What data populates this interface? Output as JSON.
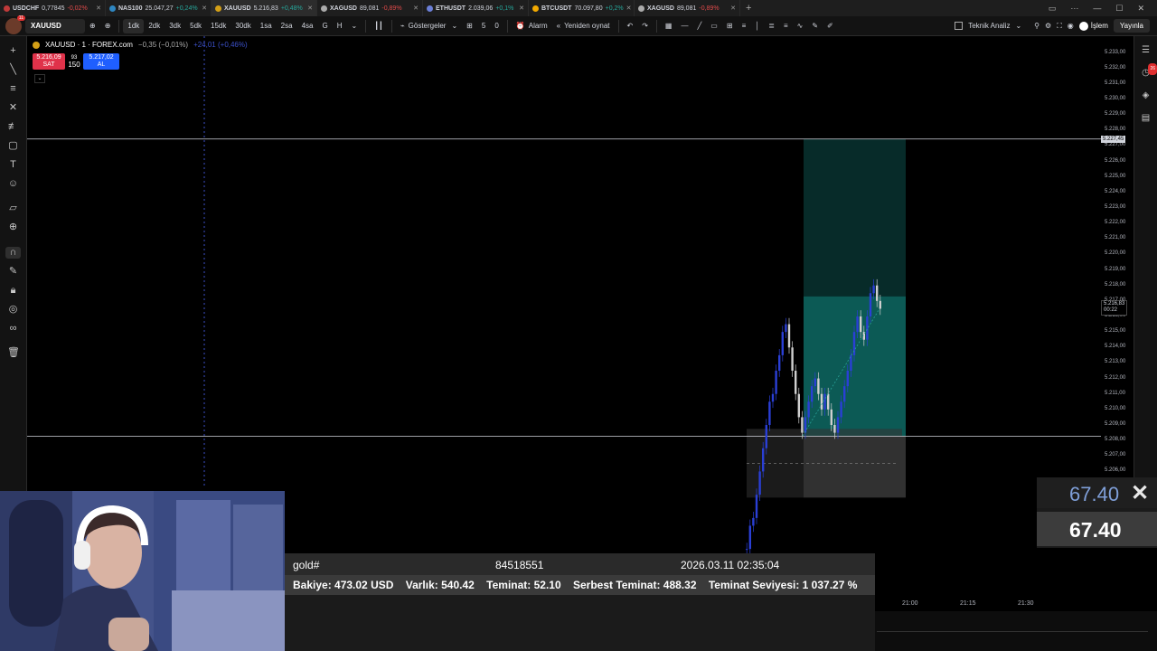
{
  "tabs": [
    {
      "symbol": "USDCHF",
      "price": "0,77845",
      "change": "-0,02%",
      "up": false,
      "color": "#c03a3a"
    },
    {
      "symbol": "NAS100",
      "price": "25.047,27",
      "change": "+0,24%",
      "up": true,
      "color": "#2e86c1"
    },
    {
      "symbol": "XAUUSD",
      "price": "5.216,83",
      "change": "+0,48%",
      "up": true,
      "color": "#d4a017"
    },
    {
      "symbol": "XAGUSD",
      "price": "89,081",
      "change": "-0,89%",
      "up": false,
      "color": "#aaaaaa"
    },
    {
      "symbol": "ETHUSDT",
      "price": "2.039,06",
      "change": "+0,1%",
      "up": true,
      "color": "#6b7fd7"
    },
    {
      "symbol": "BTCUSDT",
      "price": "70.097,80",
      "change": "+0,2%",
      "up": true,
      "color": "#f2a900"
    },
    {
      "symbol": "XAGUSD",
      "price": "89,081",
      "change": "-0,89%",
      "up": false,
      "color": "#aaaaaa"
    }
  ],
  "toolbar": {
    "symbol": "XAUUSD",
    "avatar_badge": "11",
    "timeframes": [
      "1dk",
      "2dk",
      "3dk",
      "5dk",
      "15dk",
      "30dk",
      "1sa",
      "2sa",
      "4sa",
      "G",
      "H"
    ],
    "selected_timeframe": "1dk",
    "indicators_label": "Göstergeler",
    "counter_a": "5",
    "counter_b": "0",
    "alarm_label": "Alarm",
    "replay_label": "Yeniden oynat",
    "technical_label": "Teknik Analiz",
    "trade_label": "İşlem",
    "publish_label": "Yayınla"
  },
  "legend": {
    "name": "XAUUSD · 1 · FOREX.com",
    "change": "−0,35 (−0,01%)",
    "change2": "+24,01 (+0,46%)"
  },
  "trade": {
    "sell_price": "5.216,09",
    "sell_label": "SAT",
    "buy_price": "5.217,02",
    "buy_label": "AL",
    "spread_top": "93",
    "spread_value": "150"
  },
  "price_axis": {
    "labels": [
      "5.233,00",
      "5.232,00",
      "5.231,00",
      "5.230,00",
      "5.229,00",
      "5.228,00",
      "5.227,00",
      "5.226,00",
      "5.225,00",
      "5.224,00",
      "5.223,00",
      "5.222,00",
      "5.221,00",
      "5.220,00",
      "5.219,00",
      "5.218,00",
      "5.217,00",
      "5.216,00",
      "5.215,00",
      "5.214,00",
      "5.213,00",
      "5.212,00",
      "5.211,00",
      "5.210,00",
      "5.209,00",
      "5.208,00",
      "5.207,00",
      "5.206,00"
    ],
    "line_tag": "5.227,45",
    "current_price": "5.216,83",
    "countdown": "00:22"
  },
  "time_axis": [
    "21:00",
    "21:15",
    "21:30"
  ],
  "rightbar_badge": "26",
  "account": {
    "symbol": "gold#",
    "ticket": "84518551",
    "datetime": "2026.03.11 02:35:04",
    "summary_parts": [
      "Bakiye: 473.02 USD",
      "Varlık: 540.42",
      "Teminat: 52.10",
      "Serbest Teminat: 488.32",
      "Teminat Seviyesi: 1 037.27 %"
    ]
  },
  "overlay": {
    "profit_top": "67.40",
    "profit_bottom": "67.40"
  },
  "chart_data": {
    "type": "candlestick",
    "ylim": [
      5205.5,
      5233.5
    ],
    "horizontal_lines": [
      5227.45,
      5208.28
    ],
    "position_box": {
      "entry": 5208.28,
      "take_profit": 5227.45,
      "stop_loss": 5205.0
    },
    "candles": [
      5201.0,
      5202.5,
      5203.0,
      5204.5,
      5206.0,
      5207.5,
      5209.0,
      5210.5,
      5211.0,
      5212.5,
      5213.5,
      5215.0,
      5215.5,
      5214.0,
      5212.5,
      5211.0,
      5209.5,
      5208.5,
      5209.5,
      5210.5,
      5211.5,
      5212.0,
      5211.0,
      5210.0,
      5211.0,
      5210.0,
      5209.0,
      5208.5,
      5209.5,
      5210.5,
      5211.5,
      5212.5,
      5213.5,
      5215.0,
      5216.0,
      5215.0,
      5214.5,
      5216.0,
      5217.5,
      5218.0,
      5217.0,
      5216.5
    ]
  }
}
